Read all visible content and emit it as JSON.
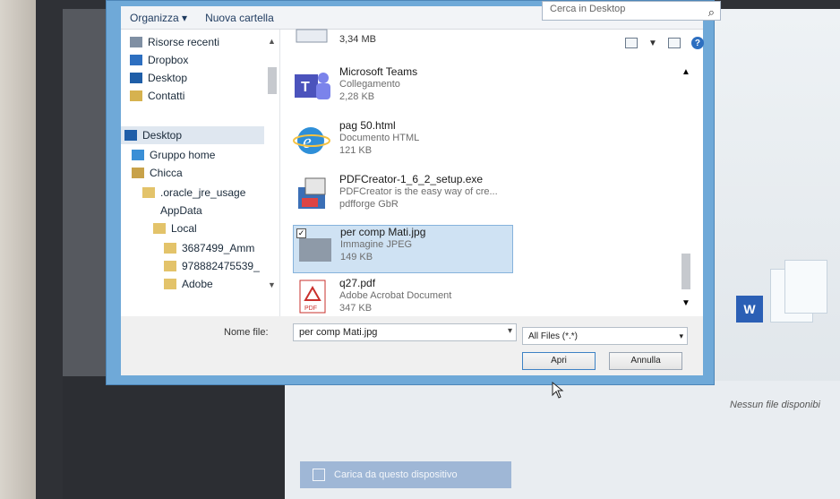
{
  "toolbar": {
    "organize": "Organizza ▾",
    "new_folder": "Nuova cartella",
    "search_placeholder": "Cerca in Desktop"
  },
  "nav": {
    "items": [
      {
        "label": "Risorse recenti",
        "icon": "recent-icon"
      },
      {
        "label": "Dropbox",
        "icon": "dropbox-icon"
      },
      {
        "label": "Desktop",
        "icon": "desktop-icon"
      },
      {
        "label": "Contatti",
        "icon": "contacts-icon"
      },
      {
        "label": "Desktop",
        "icon": "desktop-icon",
        "selected": true
      },
      {
        "label": "Gruppo home",
        "icon": "homegroup-icon"
      },
      {
        "label": "Chicca",
        "icon": "user-icon"
      },
      {
        "label": ".oracle_jre_usage",
        "icon": "folder-icon"
      },
      {
        "label": "AppData",
        "icon": "folder-icon"
      },
      {
        "label": "Local",
        "icon": "folder-icon"
      },
      {
        "label": "3687499_Amm",
        "icon": "folder-icon"
      },
      {
        "label": "978882475539_",
        "icon": "folder-icon"
      },
      {
        "label": "Adobe",
        "icon": "folder-icon"
      }
    ]
  },
  "files": [
    {
      "name": "",
      "type": "",
      "size": "3,34 MB",
      "icon": "file-icon"
    },
    {
      "name": "Microsoft Teams",
      "type": "Collegamento",
      "size": "2,28 KB",
      "icon": "teams-icon"
    },
    {
      "name": "pag 50.html",
      "type": "Documento HTML",
      "size": "121 KB",
      "icon": "ie-icon"
    },
    {
      "name": "PDFCreator-1_6_2_setup.exe",
      "type": "PDFCreator is the easy way of cre...",
      "size": "pdfforge GbR",
      "icon": "installer-icon"
    },
    {
      "name": "per comp Mati.jpg",
      "type": "Immagine JPEG",
      "size": "149 KB",
      "icon": "image-icon",
      "selected": true
    },
    {
      "name": "q27.pdf",
      "type": "Adobe Acrobat Document",
      "size": "347 KB",
      "icon": "pdf-icon"
    }
  ],
  "bottom": {
    "filename_label": "Nome file:",
    "filename_value": "per comp Mati.jpg",
    "filter_value": "All Files (*.*)",
    "open_button": "Apri",
    "cancel_button": "Annulla"
  },
  "background": {
    "empty_text": "Nessun file disponibi",
    "upload_button": "Carica da questo dispositivo"
  },
  "colors": {
    "dialog_frame": "#6fa9d8",
    "selection": "#cfe2f3",
    "accent": "#2d6fc0"
  }
}
